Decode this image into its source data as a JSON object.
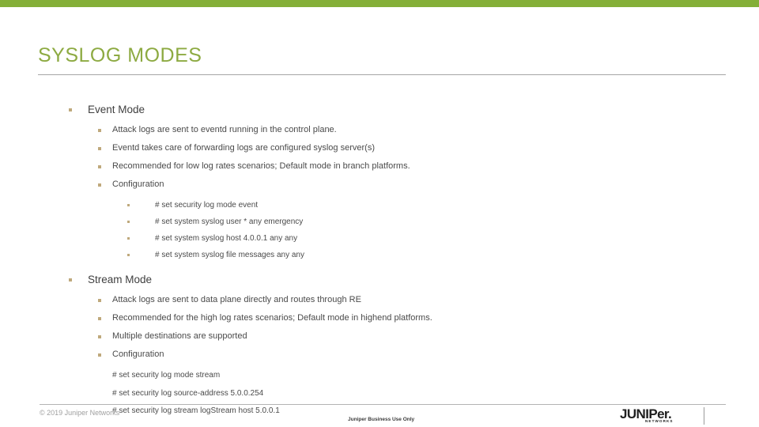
{
  "theme": {
    "accent_bar_color": "#84af38",
    "title_color": "#8daa42",
    "bullet_color": "#bfa97c",
    "rule_color": "#a6a6a6",
    "body_text_color": "#4a4a4a"
  },
  "slide": {
    "title": "SYSLOG MODES",
    "sections": [
      {
        "heading": "Event Mode",
        "points": [
          "Attack logs are sent to eventd running in the control plane.",
          "Eventd takes care of forwarding logs are configured syslog server(s)",
          "Recommended for low log rates scenarios; Default mode in branch platforms.",
          "Configuration"
        ],
        "commands": [
          "# set security log mode event",
          "# set system syslog user * any emergency",
          "# set system syslog host 4.0.0.1 any any",
          "# set system syslog file messages any any"
        ],
        "commands_bulleted": true
      },
      {
        "heading": "Stream Mode",
        "points": [
          "Attack logs are sent to data plane directly and routes through RE",
          "Recommended for the high log rates scenarios; Default mode in highend platforms.",
          "Multiple destinations are supported",
          "Configuration"
        ],
        "commands": [
          "# set security log mode stream",
          "# set security log source-address 5.0.0.254",
          "# set security log stream logStream host 5.0.0.1"
        ],
        "commands_bulleted": false
      }
    ]
  },
  "footer": {
    "copyright": "© 2019 Juniper Networks",
    "center_note": "Juniper Business Use Only",
    "logo_word": "JUNIPer.",
    "logo_sub": "NETWORKS"
  }
}
